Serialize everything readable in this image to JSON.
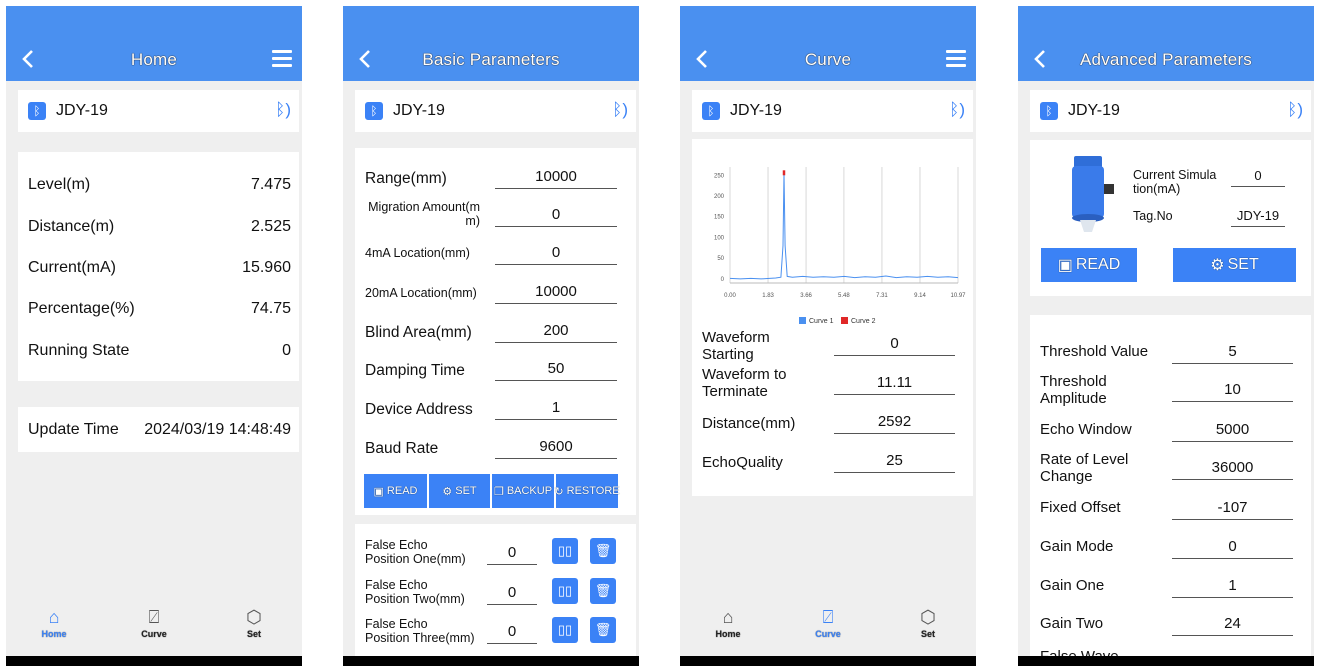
{
  "device": {
    "name": "JDY-19"
  },
  "home": {
    "title": "Home",
    "rows": [
      {
        "label": "Level(m)",
        "value": "7.475"
      },
      {
        "label": "Distance(m)",
        "value": "2.525"
      },
      {
        "label": "Current(mA)",
        "value": "15.960"
      },
      {
        "label": "Percentage(%)",
        "value": "74.75"
      },
      {
        "label": "Running State",
        "value": "0"
      }
    ],
    "update_label": "Update Time",
    "update_value": "2024/03/19 14:48:49"
  },
  "basic": {
    "title": "Basic Parameters",
    "fields": [
      {
        "label": "Range(mm)",
        "value": "10000"
      },
      {
        "label": "Migration Amount(m\nm)",
        "value": "0"
      },
      {
        "label": "4mA Location(mm)",
        "value": "0"
      },
      {
        "label": "20mA Location(mm)",
        "value": "10000"
      },
      {
        "label": "Blind Area(mm)",
        "value": "200"
      },
      {
        "label": "Damping Time",
        "value": "50"
      },
      {
        "label": "Device Address",
        "value": "1"
      },
      {
        "label": "Baud Rate",
        "value": "9600"
      }
    ],
    "buttons": {
      "read": "READ",
      "set": "SET",
      "backup": "BACKUP",
      "restore": "RESTORE"
    },
    "false_echo": [
      {
        "label": "False Echo\nPosition One(mm)",
        "value": "0"
      },
      {
        "label": "False Echo\nPosition Two(mm)",
        "value": "0"
      },
      {
        "label": "False Echo\nPosition Three(mm)",
        "value": "0"
      }
    ]
  },
  "curve": {
    "title": "Curve",
    "fields": [
      {
        "label": "Waveform\nStarting",
        "value": "0"
      },
      {
        "label": "Waveform to\nTerminate",
        "value": "11.11"
      },
      {
        "label": "Distance(mm)",
        "value": "2592"
      },
      {
        "label": "EchoQuality",
        "value": "25"
      }
    ]
  },
  "chart_data": {
    "type": "line",
    "x_ticks": [
      "0.00",
      "1.83",
      "3.66",
      "5.48",
      "7.31",
      "9.14",
      "10.97"
    ],
    "y_ticks": [
      "0",
      "50",
      "100",
      "150",
      "200",
      "250"
    ],
    "xlim": [
      0,
      10.97
    ],
    "ylim": [
      -10,
      270
    ],
    "series": [
      {
        "name": "Curve 1",
        "color": "#4a90f0",
        "x": [
          0,
          0.5,
          1.0,
          1.5,
          1.9,
          2.2,
          2.45,
          2.55,
          2.6,
          2.65,
          2.75,
          3.0,
          3.5,
          4.0,
          4.5,
          5.0,
          5.5,
          6.0,
          6.5,
          7.0,
          7.5,
          8.0,
          8.5,
          9.0,
          9.5,
          10.0,
          10.5,
          10.97
        ],
        "y": [
          1,
          0,
          1,
          0,
          1,
          2,
          4,
          80,
          258,
          80,
          6,
          4,
          6,
          4,
          5,
          4,
          6,
          3,
          5,
          4,
          7,
          3,
          5,
          4,
          6,
          4,
          5,
          3
        ]
      },
      {
        "name": "Curve 2",
        "color": "#e02828",
        "x": [
          2.6,
          2.6
        ],
        "y": [
          250,
          262
        ]
      }
    ]
  },
  "advanced": {
    "title": "Advanced Parameters",
    "sim_label": "Current Simula\ntion(mA)",
    "sim_value": "0",
    "tag_label": "Tag.No",
    "tag_value": "JDY-19",
    "read": "READ",
    "set": "SET",
    "fields": [
      {
        "label": "Threshold Value",
        "value": "5"
      },
      {
        "label": "Threshold\nAmplitude",
        "value": "10"
      },
      {
        "label": "Echo Window",
        "value": "5000"
      },
      {
        "label": "Rate of Level\nChange",
        "value": "36000"
      },
      {
        "label": "Fixed Offset",
        "value": "-107"
      },
      {
        "label": "Gain Mode",
        "value": "0"
      },
      {
        "label": "Gain One",
        "value": "1"
      },
      {
        "label": "Gain Two",
        "value": "24"
      },
      {
        "label": "False Wave",
        "value": ""
      }
    ]
  },
  "tabs": [
    {
      "label": "Home",
      "icon": "home-icon"
    },
    {
      "label": "Curve",
      "icon": "curve-icon"
    },
    {
      "label": "Set",
      "icon": "settings-icon"
    }
  ],
  "colors": {
    "primary": "#4a90f0",
    "button": "#3b82f6",
    "background": "#efefef",
    "curve2": "#e02828"
  }
}
